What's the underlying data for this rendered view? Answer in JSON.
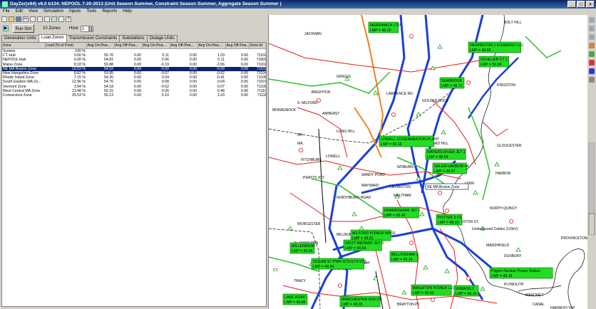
{
  "window": {
    "title": "DayZer(x64) v6.0 b134: NEPOOL 7-20-2013  (Unit Season Summer, Constraint Season Summer, Aggregate Season Summer )"
  },
  "menu": [
    "File",
    "Edit",
    "View",
    "Simulation",
    "Inputs",
    "Tools",
    "Reports",
    "Help"
  ],
  "controls": {
    "run_label": "Run Sim",
    "zones_label": "10 Zones",
    "hour_label": "Hour",
    "hour_value": "1"
  },
  "tabs": [
    "Generation Units",
    "Load Zones",
    "Transmission Constraints",
    "Substations",
    "Outage Units"
  ],
  "active_tab": 1,
  "table": {
    "headers": [
      "Zone",
      "Load (% of Pool)",
      "Avg On-Pea...",
      "Avg Off-Pea...",
      "Avg On-Pea...",
      "Avg Off-Pea...",
      "Avg On-Pea...",
      "Avg Off-Pea...",
      "Zone Id"
    ],
    "rows": [
      [
        "System",
        "100 %",
        "",
        "",
        "",
        "",
        "",
        "",
        ""
      ],
      [
        "CT Hub",
        "0.00 %",
        "55.76",
        "0.00",
        "0.11",
        "0.00",
        "1.03",
        "0.00",
        "71102"
      ],
      [
        "NEPOOL Hub",
        "0.00 %",
        "54.81",
        "0.00",
        "0.06",
        "0.00",
        "0.11",
        "0.00",
        "71001"
      ],
      [
        "Maine Zone",
        "8.18 %",
        "50.88",
        "0.00",
        "-0.19",
        "0.00",
        "-3.56",
        "0.00",
        "71102"
      ],
      [
        "NE MA Boston Zone",
        "19.53 %",
        "54.52",
        "0.00",
        "-0.02",
        "0.00",
        "-0.09",
        "0.00",
        "71103"
      ],
      [
        "New Hampshire Zone",
        "8.82 %",
        "53.95",
        "0.00",
        "-0.07",
        "0.00",
        "-0.62",
        "0.00",
        "71104"
      ],
      [
        "Rhode Island Zone",
        "7.15 %",
        "54.26",
        "0.00",
        "0.04",
        "0.00",
        "-0.41",
        "0.00",
        "71106"
      ],
      [
        "South Eastern MA Zo...",
        "12.96 %",
        "54.76",
        "0.00",
        "0.08",
        "0.00",
        "0.04",
        "0.00",
        "71107"
      ],
      [
        "Vermont Zone",
        "3.94 %",
        "54.18",
        "0.00",
        "-0.52",
        "0.00",
        "0.07",
        "0.00",
        "71109"
      ],
      [
        "West Central MA Zone",
        "13.48 %",
        "55.15",
        "0.00",
        "0.05",
        "0.00",
        "0.46",
        "0.00",
        "71110"
      ],
      [
        "Connecticut Zone",
        "25.53 %",
        "55.13",
        "0.00",
        "0.10",
        "0.00",
        "1.03",
        "0.00",
        "71111"
      ]
    ],
    "selected_row": 4
  },
  "map": {
    "places": [
      "JACKMAN",
      "BOLT HILL",
      "NEWINGTON",
      "KINGSTON",
      "MONADNOCK",
      "S. MILFORD",
      "AMHERST",
      "NH",
      "MA.",
      "LONG HILL",
      "LAWRENCE RD.",
      "GOLDEN ROCK",
      "WARD HILL",
      "GLOUCESTER",
      "FITCHBURG",
      "PRATTS JCT.",
      "SANDY POND",
      "WOBURN",
      "HARBOR",
      "MAYNARD",
      "LEXINGTON",
      "NORTHBORO ROAD",
      "WALTHAM",
      "LYNN",
      "NORTH QUINCY",
      "KINGSTON ST.",
      "WORCESTER",
      "W. CHARLTON",
      "MILLBURY",
      "MEDWAY",
      "MARSHFIELD",
      "PROVINCETOWN",
      "UXBRIDGE",
      "TRACY",
      "CT.",
      "PLYMOUTH",
      "BRAYTON PT.",
      "HARWICH TAP",
      "MANOMET",
      "CANAL",
      "GRIGGS",
      "BRIGHTON",
      "Underground Cables (115kV)",
      "DUXBURY",
      "LOWELL"
    ],
    "zone_tag": "NE MA Boston Zone",
    "lmp_boxes": [
      {
        "name": "MERRIMACK CT2",
        "lmp": "LMP = 48.20"
      },
      {
        "name": "NEWINGTON 1 N ENERGY LLC",
        "lmp": "LMP = 48.85"
      },
      {
        "name": "SCHILLER CT 1",
        "lmp": "LMP = 50.84"
      },
      {
        "name": "SEABROOK",
        "lmp": "LMP = 48.71"
      },
      {
        "name": "LOWELL COGENERATION PLANT",
        "lmp": "LMP = 50.18"
      },
      {
        "name": "WATERS RIVER JET 2",
        "lmp": "LMP = 48.64"
      },
      {
        "name": "SALEM HARBOR #4",
        "lmp": "LMP = 49.57"
      },
      {
        "name": "FRAMINGHAM JET 2",
        "lmp": "LMP = 59.46"
      },
      {
        "name": "POTTER 2 CC",
        "lmp": "LMP = 48.33"
      },
      {
        "name": "MILFORD POWER MASS",
        "lmp": "LMP = 49.62"
      },
      {
        "name": "WEST MEDWAY JET 3",
        "lmp": "LMP = 50.64"
      },
      {
        "name": "MILLENNIUM",
        "lmp": "LMP = 49.05"
      },
      {
        "name": "BELLINGHAM 2",
        "lmp": "LMP = 49.14"
      },
      {
        "name": "OCEAN ST PWR GT3-GT4-ST2",
        "lmp": "LMP = 48.84"
      },
      {
        "name": "Pilgrim Nuclear Power Station",
        "lmp": "LMP = 49.18"
      },
      {
        "name": "BRIGHTON POWER LLC",
        "lmp": "LMP = 49.00"
      },
      {
        "name": "MANCHESTER 9/10 CC",
        "lmp": "LMP = 48.35"
      },
      {
        "name": "LAKE ROAD",
        "lmp": "LMP = 48.88"
      },
      {
        "name": "KEMASS 2",
        "lmp": "LMP = 49.16"
      }
    ]
  },
  "colors": {
    "selection": "#0a246a",
    "lmp_box": "#22dd22",
    "line_345": "#1a3fd6",
    "line_115": "#e41b1b",
    "line_230": "#2ac02a"
  }
}
